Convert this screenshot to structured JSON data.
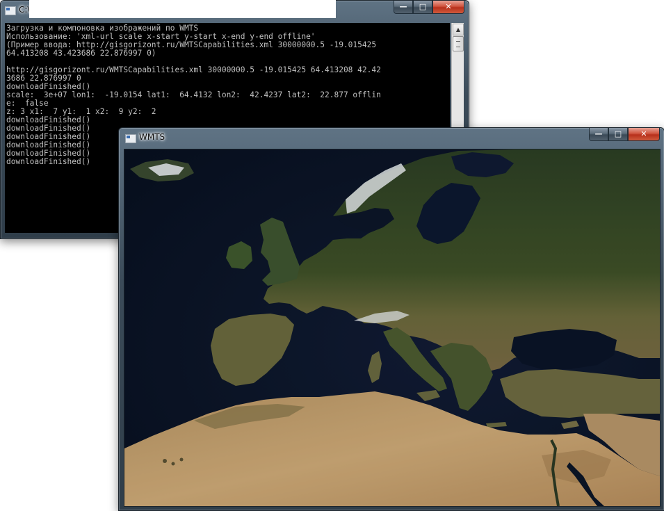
{
  "console": {
    "title": "C:\\",
    "lines": [
      "Загрузка и компоновка изображений по WMTS",
      "Использование: 'xml-url scale x-start y-start x-end y-end offline'",
      "(Пример ввода: http://gisgorizont.ru/WMTSCapabilities.xml 30000000.5 -19.015425",
      "64.413208 43.423686 22.876997 0)",
      "",
      "http://gisgorizont.ru/WMTSCapabilities.xml 30000000.5 -19.015425 64.413208 42.42",
      "3686 22.876997 0",
      "downloadFinished()",
      "scale:  3e+07 lon1:  -19.0154 lat1:  64.4132 lon2:  42.4237 lat2:  22.877 offlin",
      "e:  false",
      "z: 3 x1:  7 y1:  1 x2:  9 y2:  2",
      "downloadFinished()",
      "downloadFinished()",
      "downloadFinished()",
      "downloadFinished()",
      "downloadFinished()",
      "downloadFinished()"
    ]
  },
  "wmts": {
    "title": "WMTS"
  },
  "window_controls": {
    "minimize": "—",
    "maximize": "□",
    "close": "✕"
  },
  "icons": {
    "app": "console-app-icon",
    "scroll_up": "▲",
    "scroll_down": "▼"
  },
  "map_colors": {
    "ocean": "#0b1527",
    "forest": "#2f4326",
    "lowland": "#4a5a30",
    "desert": "#c8a473",
    "desert_dark": "#a88356",
    "snow": "#e8ecef"
  }
}
